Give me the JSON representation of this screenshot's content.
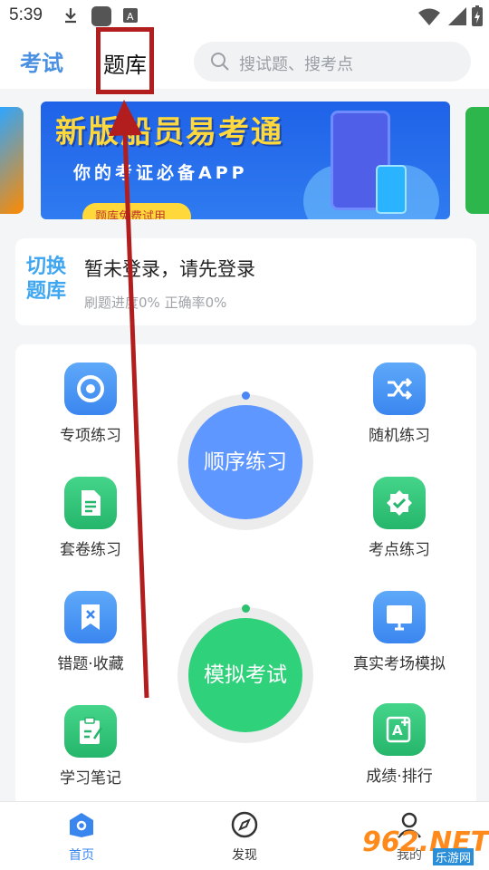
{
  "status_bar": {
    "time": "5:39"
  },
  "header": {
    "tabs": [
      "考试",
      "题库"
    ],
    "search_placeholder": "搜试题、搜考点"
  },
  "banner": {
    "title": "新版船员易考通",
    "subtitle": "你的考证必备APP",
    "pill": "题库免费试用"
  },
  "login_card": {
    "switch_label_1": "切换",
    "switch_label_2": "题库",
    "message": "暂未登录，请先登录",
    "progress": "刷题进度0% 正确率0%"
  },
  "practice": {
    "items": [
      {
        "label": "专项练习",
        "icon": "target-icon"
      },
      {
        "label": "随机练习",
        "icon": "shuffle-icon"
      },
      {
        "label": "套卷练习",
        "icon": "document-icon"
      },
      {
        "label": "考点练习",
        "icon": "badge-check-icon"
      },
      {
        "label": "错题·收藏",
        "icon": "bookmark-x-icon"
      },
      {
        "label": "真实考场模拟",
        "icon": "monitor-icon"
      },
      {
        "label": "学习笔记",
        "icon": "clipboard-edit-icon"
      },
      {
        "label": "成绩·排行",
        "icon": "grade-a-plus-icon"
      }
    ],
    "sequential": "顺序练习",
    "mock_exam": "模拟考试"
  },
  "bottom_nav": {
    "items": [
      {
        "label": "首页",
        "icon": "home-icon"
      },
      {
        "label": "发现",
        "icon": "compass-icon"
      },
      {
        "label": "我的",
        "icon": "user-icon"
      }
    ]
  },
  "watermark": {
    "brand": "962.NET",
    "site": "乐游网"
  },
  "colors": {
    "accent": "#3a86ef",
    "green": "#2fd27a",
    "annotation": "#b21d1d"
  }
}
